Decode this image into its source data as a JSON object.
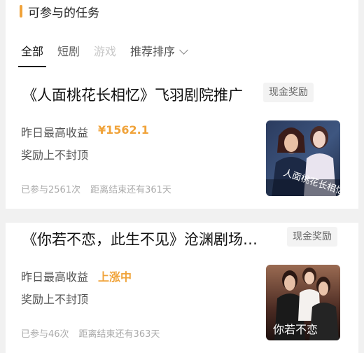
{
  "section": {
    "title": "可参与的任务",
    "accent_color": "#f0a33a"
  },
  "tabs": [
    {
      "label": "全部",
      "state": "active"
    },
    {
      "label": "短剧",
      "state": "normal"
    },
    {
      "label": "游戏",
      "state": "disabled"
    },
    {
      "label": "推荐排序",
      "state": "normal",
      "icon": "chevron-down-icon"
    }
  ],
  "tasks": [
    {
      "title": "《人面桃花长相忆》飞羽剧院推广",
      "badge": "现金奖励",
      "metric_label": "昨日最高收益",
      "metric_value": "¥1562.1",
      "subtitle": "奖励上不封顶",
      "participants": "已参与2561次",
      "deadline": "距离结束还有361天",
      "poster_text": "人面桃花长相忆"
    },
    {
      "title": "《你若不恋，此生不见》沧渊剧场…",
      "badge": "现金奖励",
      "metric_label": "昨日最高收益",
      "metric_value": "上涨中",
      "subtitle": "奖励上不封顶",
      "participants": "已参与46次",
      "deadline": "距离结束还有363天",
      "poster_text": "你若不恋"
    }
  ]
}
